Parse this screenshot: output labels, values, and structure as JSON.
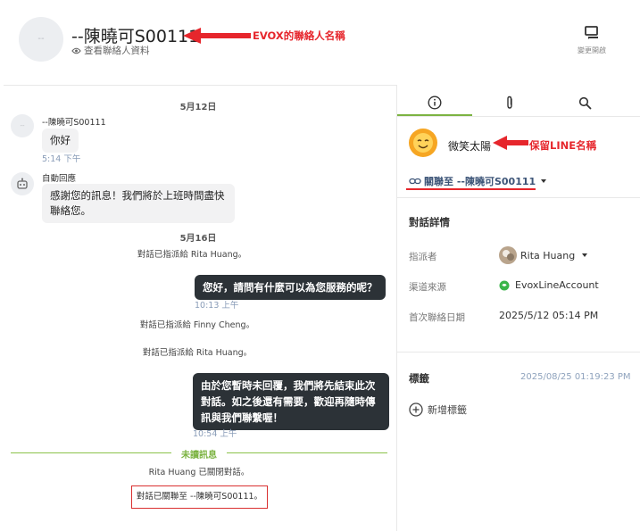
{
  "header": {
    "avatar_text": "--",
    "contact_name": "--陳曉可S00111",
    "view_profile": "查看聯絡人資料",
    "annotation": "EVOX的聯絡人名稱",
    "switch_label": "變更開啟"
  },
  "chat": {
    "date1": "5月12日",
    "msg1": {
      "avatar_text": "--",
      "sender": "--陳曉可S00111",
      "text": "你好",
      "time": "5:14 下午"
    },
    "msg2": {
      "sender": "自動回應",
      "text": "感謝您的訊息！我們將於上班時間盡快聯絡您。"
    },
    "date2": "5月16日",
    "sys1": "對話已指派給 Rita Huang。",
    "out1": {
      "text": "您好，請問有什麼可以為您服務的呢？",
      "time": "10:13 上午"
    },
    "sys2": "對話已指派給 Finny Cheng。",
    "sys3": "對話已指派給 Rita Huang。",
    "out2": {
      "text": "由於您暫時未回覆，我們將先結束此次對話。如之後還有需要，歡迎再隨時傳訊與我們聯繫喔！",
      "time": "10:54 上午"
    },
    "unread": "未讀訊息",
    "sys4": "Rita Huang 已關閉對話。",
    "linked_notice": "對話已關聯至 --陳曉可S00111。"
  },
  "panel": {
    "tabs": [
      {
        "icon": "info-icon",
        "active": true
      },
      {
        "icon": "paperclip-icon",
        "active": false
      },
      {
        "icon": "search-icon",
        "active": false
      }
    ],
    "line_name": "微笑太陽",
    "line_annotation": "保留LINE名稱",
    "link_label": "關聯至 --陳曉可S00111",
    "details_title": "對話詳情",
    "assignee_label": "指派者",
    "assignee": "Rita Huang",
    "channel_label": "渠道來源",
    "channel": "EvoxLineAccount",
    "first_contact_label": "首次聯絡日期",
    "first_contact": "2025/5/12 05:14 PM",
    "tags_label": "標籤",
    "tags_time": "2025/08/25 01:19:23 PM",
    "add_tag": "新增標籤"
  },
  "colors": {
    "accent_green": "#7cb342",
    "annotation_red": "#e6262c",
    "outgoing_bubble": "#2c3237",
    "link_blue": "#3d5578"
  }
}
